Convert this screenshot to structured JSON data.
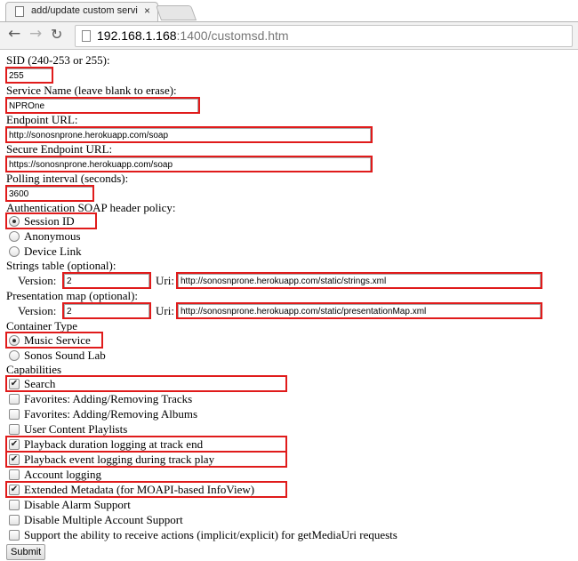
{
  "browser": {
    "tab_title": "add/update custom servic",
    "tab_close": "×",
    "url_host": "192.168.1.168",
    "url_rest": ":1400/customsd.htm"
  },
  "form": {
    "sid_label": "SID (240-253 or 255):",
    "sid_value": "255",
    "service_name_label": "Service Name (leave blank to erase):",
    "service_name_value": "NPROne",
    "endpoint_label": "Endpoint URL:",
    "endpoint_value": "http://sonosnprone.herokuapp.com/soap",
    "secure_endpoint_label": "Secure Endpoint URL:",
    "secure_endpoint_value": "https://sonosnprone.herokuapp.com/soap",
    "polling_label": "Polling interval (seconds):",
    "polling_value": "3600",
    "auth_label": "Authentication SOAP header policy:",
    "auth_options": [
      {
        "label": "Session ID",
        "checked": true
      },
      {
        "label": "Anonymous",
        "checked": false
      },
      {
        "label": "Device Link",
        "checked": false
      }
    ],
    "strings_label": "Strings table (optional):",
    "strings_version_label": "Version:",
    "strings_version_value": "2",
    "strings_uri_label": "Uri:",
    "strings_uri_value": "http://sonosnprone.herokuapp.com/static/strings.xml",
    "presentation_label": "Presentation map (optional):",
    "presentation_version_label": "Version:",
    "presentation_version_value": "2",
    "presentation_uri_label": "Uri:",
    "presentation_uri_value": "http://sonosnprone.herokuapp.com/static/presentationMap.xml",
    "container_label": "Container Type",
    "container_options": [
      {
        "label": "Music Service",
        "checked": true
      },
      {
        "label": "Sonos Sound Lab",
        "checked": false
      }
    ],
    "capabilities_label": "Capabilities",
    "capabilities": [
      {
        "label": "Search",
        "checked": true
      },
      {
        "label": "Favorites: Adding/Removing Tracks",
        "checked": false
      },
      {
        "label": "Favorites: Adding/Removing Albums",
        "checked": false
      },
      {
        "label": "User Content Playlists",
        "checked": false
      },
      {
        "label": "Playback duration logging at track end",
        "checked": true
      },
      {
        "label": "Playback event logging during track play",
        "checked": true
      },
      {
        "label": "Account logging",
        "checked": false
      },
      {
        "label": "Extended Metadata (for MOAPI-based InfoView)",
        "checked": true
      },
      {
        "label": "Disable Alarm Support",
        "checked": false
      },
      {
        "label": "Disable Multiple Account Support",
        "checked": false
      },
      {
        "label": "Support the ability to receive actions (implicit/explicit) for getMediaUri requests",
        "checked": false
      }
    ],
    "submit_label": "Submit"
  },
  "highlight_color": "#e01b1b",
  "icons": {
    "back": "back-arrow-icon",
    "forward": "forward-arrow-icon",
    "reload": "reload-icon",
    "page": "page-icon",
    "checkmark": "checkmark-icon"
  }
}
